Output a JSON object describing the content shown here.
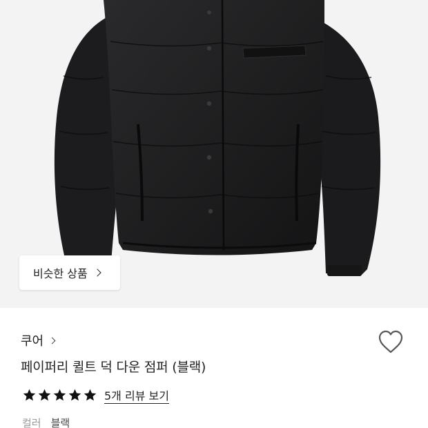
{
  "hero": {
    "image_icon": "black-quilted-down-jacket-photo",
    "similar_button_label": "비슷한 상품",
    "similar_button_icon": "chevron-right-icon"
  },
  "product": {
    "brand": "쿠어",
    "brand_icon": "chevron-right-icon",
    "wishlist_icon": "heart-outline-icon",
    "title": "페이퍼리 퀼트 덕 다운 점퍼 (블랙)",
    "rating": {
      "stars": 5,
      "max": 5,
      "color": "#111111"
    },
    "review_link": "5개 리뷰 보기",
    "option_label": "컬러",
    "option_value": "블랙"
  },
  "colors": {
    "background": "#ffffff",
    "photo_bg": "#f3f3f4",
    "text": "#222222",
    "muted": "#999999"
  }
}
